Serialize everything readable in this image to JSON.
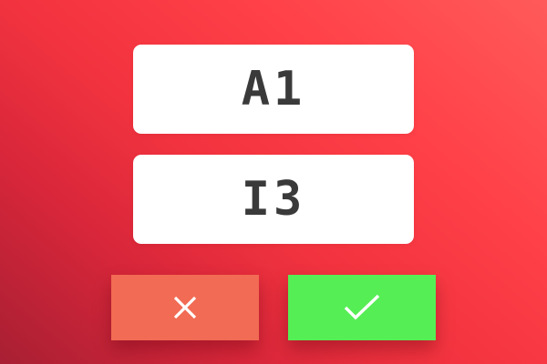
{
  "codes": [
    {
      "value": "A1"
    },
    {
      "value": "I3"
    }
  ],
  "actions": {
    "cancel": {
      "icon": "close-icon",
      "color": "#f26b54"
    },
    "confirm": {
      "icon": "check-icon",
      "color": "#55ee55"
    }
  },
  "theme": {
    "background_start": "#a81f33",
    "background_end": "#ff5a5a",
    "card_color": "#ffffff",
    "text_color": "#3a3a3a",
    "icon_color": "#ffffff"
  }
}
